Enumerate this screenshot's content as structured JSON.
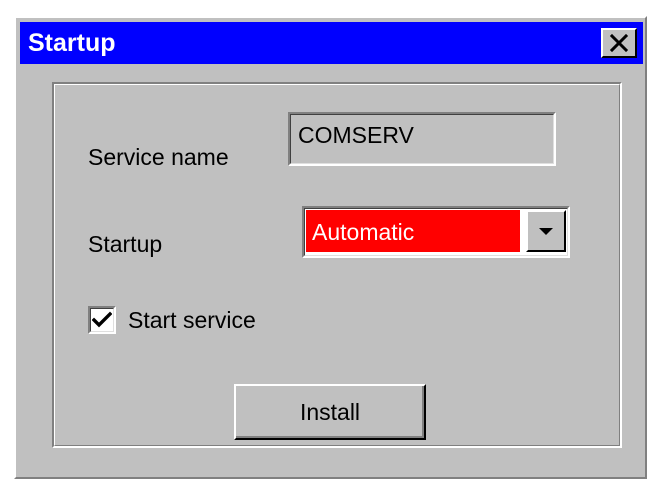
{
  "window": {
    "title": "Startup",
    "close_icon": "close-icon",
    "colors": {
      "titlebar": "#0000ff",
      "title_text": "#ffffff",
      "face": "#c0c0c0",
      "selection": "#ff0000"
    }
  },
  "form": {
    "service_name": {
      "label": "Service name",
      "value": "COMSERV"
    },
    "startup": {
      "label": "Startup",
      "selected": "Automatic",
      "dropdown_icon": "chevron-down-icon"
    },
    "start_service": {
      "label": "Start service",
      "checked": true,
      "check_icon": "checkmark-icon"
    },
    "install_button": {
      "label": "Install"
    }
  }
}
